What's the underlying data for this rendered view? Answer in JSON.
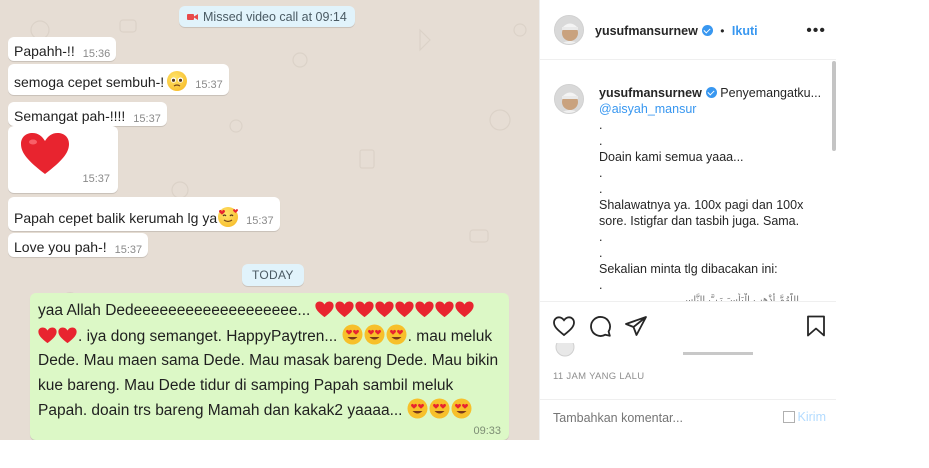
{
  "chat": {
    "missed_call": "Missed video call at 09:14",
    "today_label": "TODAY",
    "incoming": [
      {
        "text": "Papahh-!!",
        "time": "15:36"
      },
      {
        "text": "semoga cepet sembuh-!",
        "time": "15:37",
        "emoji": "pleading-face"
      },
      {
        "text": "Semangat pah-!!!!",
        "time": "15:37"
      },
      {
        "text": "",
        "time": "15:37",
        "emoji": "red-heart"
      },
      {
        "text": "Papah cepet balik kerumah lg ya",
        "time": "15:37",
        "emoji": "smiling-face-with-hearts"
      },
      {
        "text": "Love you pah-!",
        "time": "15:37"
      }
    ],
    "outgoing": {
      "line1": "yaa Allah Dedeeeeeeeeeeeeeeeeeee...",
      "line2": ". iya dong semanget. HappyPaytren...",
      "line2b": ". mau meluk",
      "line3": "Dede. Mau maen sama Dede. Mau masak bareng Dede. Mau bikin",
      "line4": "kue bareng. Mau Dede tidur di samping Papah sambil meluk",
      "line5": "Papah. doain trs bareng Mamah dan kakak2 yaaaa...",
      "time": "09:33",
      "hearts_line1": 8,
      "hearts_line2": 2
    },
    "bg_color": "#e6ddd4",
    "outgoing_color": "#dcf8c6"
  },
  "instagram": {
    "header": {
      "username": "yusufmansurnew",
      "separator": "•",
      "follow_label": "Ikuti",
      "more_label": "•••"
    },
    "caption": {
      "username": "yusufmansurnew",
      "first_line": "Penyemangatku...",
      "mention": "@aisyah_mansur",
      "lines": [
        ".",
        ".",
        "Doain kami semua yaaa...",
        ".",
        ".",
        "Shalawatnya ya. 100x pagi dan 100x",
        "sore. Istigfar dan tasbih juga. Sama.",
        ".",
        ".",
        "Sekalian minta tlg dibacakan ini:",
        "."
      ],
      "arabic_partial": "اللَّهُمَّ أَذْهِبِ الْبَأْسَ رَبَّ النَّاسِ"
    },
    "time_ago": "11 JAM YANG LALU",
    "comment_placeholder": "Tambahkan komentar...",
    "post_label": "Kirim",
    "accent_color": "#3897f0"
  }
}
